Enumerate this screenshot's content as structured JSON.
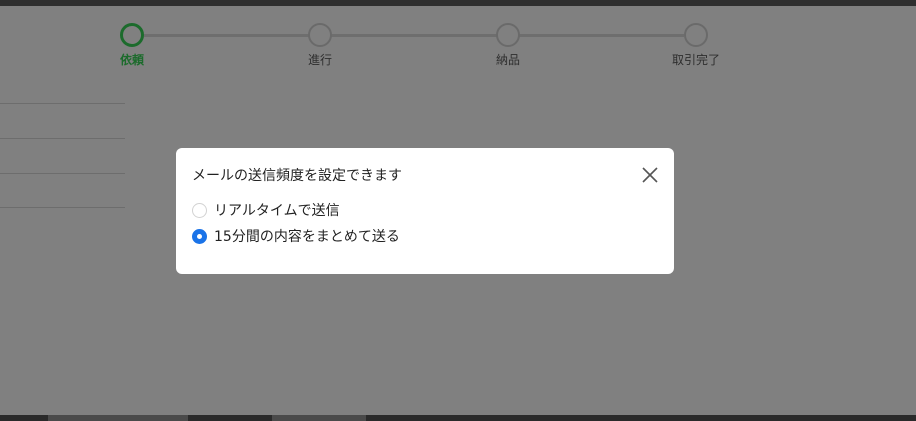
{
  "stepper": {
    "steps": [
      {
        "label": "依頼",
        "active": true
      },
      {
        "label": "進行",
        "active": false
      },
      {
        "label": "納品",
        "active": false
      },
      {
        "label": "取引完了",
        "active": false
      }
    ],
    "active_color": "#1c6b2c"
  },
  "dialog": {
    "title": "メールの送信頻度を設定できます",
    "options": [
      {
        "label": "リアルタイムで送信",
        "checked": false
      },
      {
        "label": "15分間の内容をまとめて送る",
        "checked": true
      }
    ],
    "accent_color": "#1a73e8",
    "close_icon": "close-icon"
  }
}
